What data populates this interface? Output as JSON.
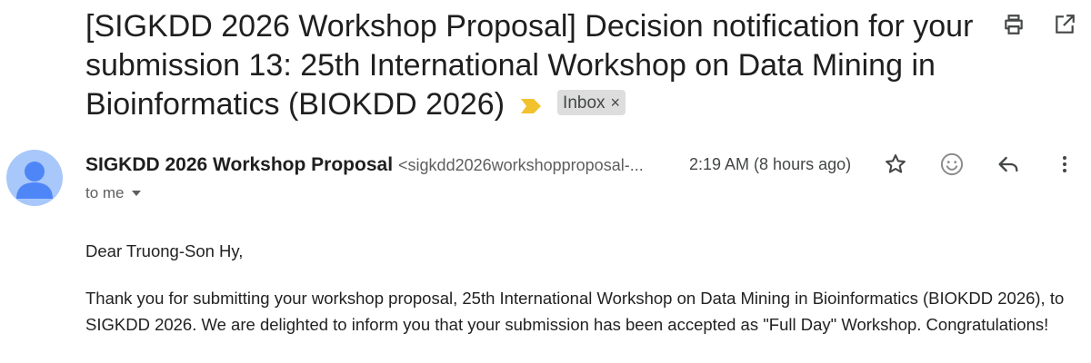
{
  "subject": {
    "text": "[SIGKDD 2026 Workshop Proposal] Decision notification for your submission 13: 25th International Workshop on Data Mining in Bioinformatics (BIOKDD 2026)",
    "label": "Inbox",
    "label_remove": "×",
    "marker_color": "#f2c12e"
  },
  "toolbar": {
    "print_icon": "print-icon",
    "open_new_window_icon": "open-in-new-window-icon"
  },
  "message": {
    "sender_name": "SIGKDD 2026 Workshop Proposal",
    "sender_email": "<sigkdd2026workshopproposal-...",
    "timestamp": "2:19 AM (8 hours ago)",
    "recipients": "to me",
    "actions": {
      "star_icon": "star-icon",
      "emoji_icon": "emoji-reaction-icon",
      "reply_icon": "reply-icon",
      "more_icon": "more-vert-icon"
    },
    "avatar_color": "#a8c7fa",
    "avatar_fg_color": "#4f86f7"
  },
  "body": {
    "greeting": "Dear Truong-Son Hy,",
    "paragraph1": "Thank you for submitting your workshop proposal, 25th International Workshop on Data Mining in Bioinformatics (BIOKDD 2026), to SIGKDD 2026. We are delighted to inform you that your submission has been accepted as \"Full Day\" Workshop. Congratulations!"
  }
}
